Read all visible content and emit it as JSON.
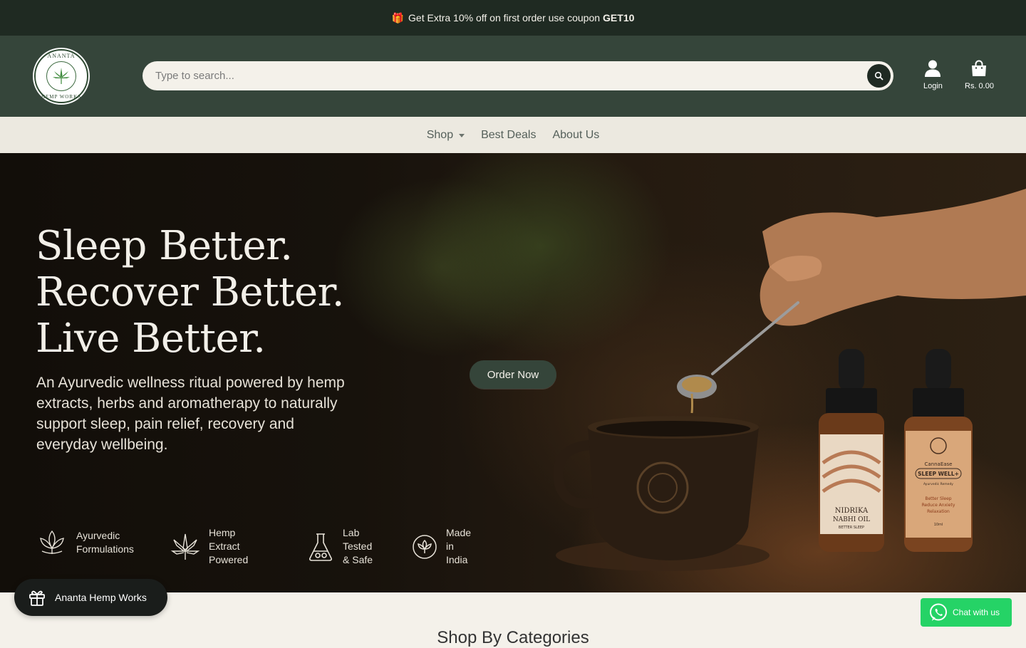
{
  "announcement": {
    "text": "Get Extra 10% off on first order use coupon",
    "code": "GET10",
    "icon": "gift-icon"
  },
  "header": {
    "logo": {
      "alt": "Ananta Hemp Works",
      "text_top": "ANANTA",
      "text_bottom": "HEMP WORKS"
    },
    "search": {
      "placeholder": "Type to search...",
      "icon": "search-icon"
    },
    "login": {
      "label": "Login",
      "icon": "user-icon"
    },
    "cart": {
      "label": "Rs. 0.00",
      "icon": "shopping-bag-icon"
    }
  },
  "nav": {
    "items": [
      {
        "label": "Shop",
        "has_dropdown": true
      },
      {
        "label": "Best Deals"
      },
      {
        "label": "About Us"
      }
    ]
  },
  "hero": {
    "headline": [
      "Sleep Better.",
      "Recover Better.",
      "Live Better."
    ],
    "subtext": "An Ayurvedic wellness ritual powered by hemp extracts, herbs and aromatherapy to naturally support sleep, pain relief, recovery and everyday wellbeing.",
    "cta": "Order Now",
    "features": [
      {
        "line1": "Ayurvedic",
        "line2": "Formulations",
        "icon": "lotus-icon"
      },
      {
        "line1": "Hemp Extract",
        "line2": "Powered",
        "icon": "hemp-leaf-icon"
      },
      {
        "line1": "Lab Tested",
        "line2": "& Safe",
        "icon": "flask-icon"
      },
      {
        "line1": "Made in",
        "line2": "India",
        "icon": "india-emblem-icon"
      }
    ],
    "bottle1": {
      "line1": "NIDRIKA",
      "line2": "NABHI OIL",
      "line3": "BETTER SLEEP"
    },
    "bottle2": {
      "brand": "CannaEase",
      "name": "SLEEP WELL+",
      "tag": "Ayurvedic Remedy",
      "benefits": [
        "Better Sleep",
        "Reduce Anxiety",
        "Relaxation"
      ],
      "volume": "10ml"
    }
  },
  "section": {
    "title": "Shop By Categories"
  },
  "rewards": {
    "label": "Ananta Hemp Works",
    "icon": "gift-icon"
  },
  "whatsapp": {
    "label": "Chat with us",
    "icon": "whatsapp-icon"
  },
  "colors": {
    "dark": "#1f2a22",
    "header": "#35453a",
    "cream": "#f4f1ea",
    "whatsapp": "#25d366"
  }
}
